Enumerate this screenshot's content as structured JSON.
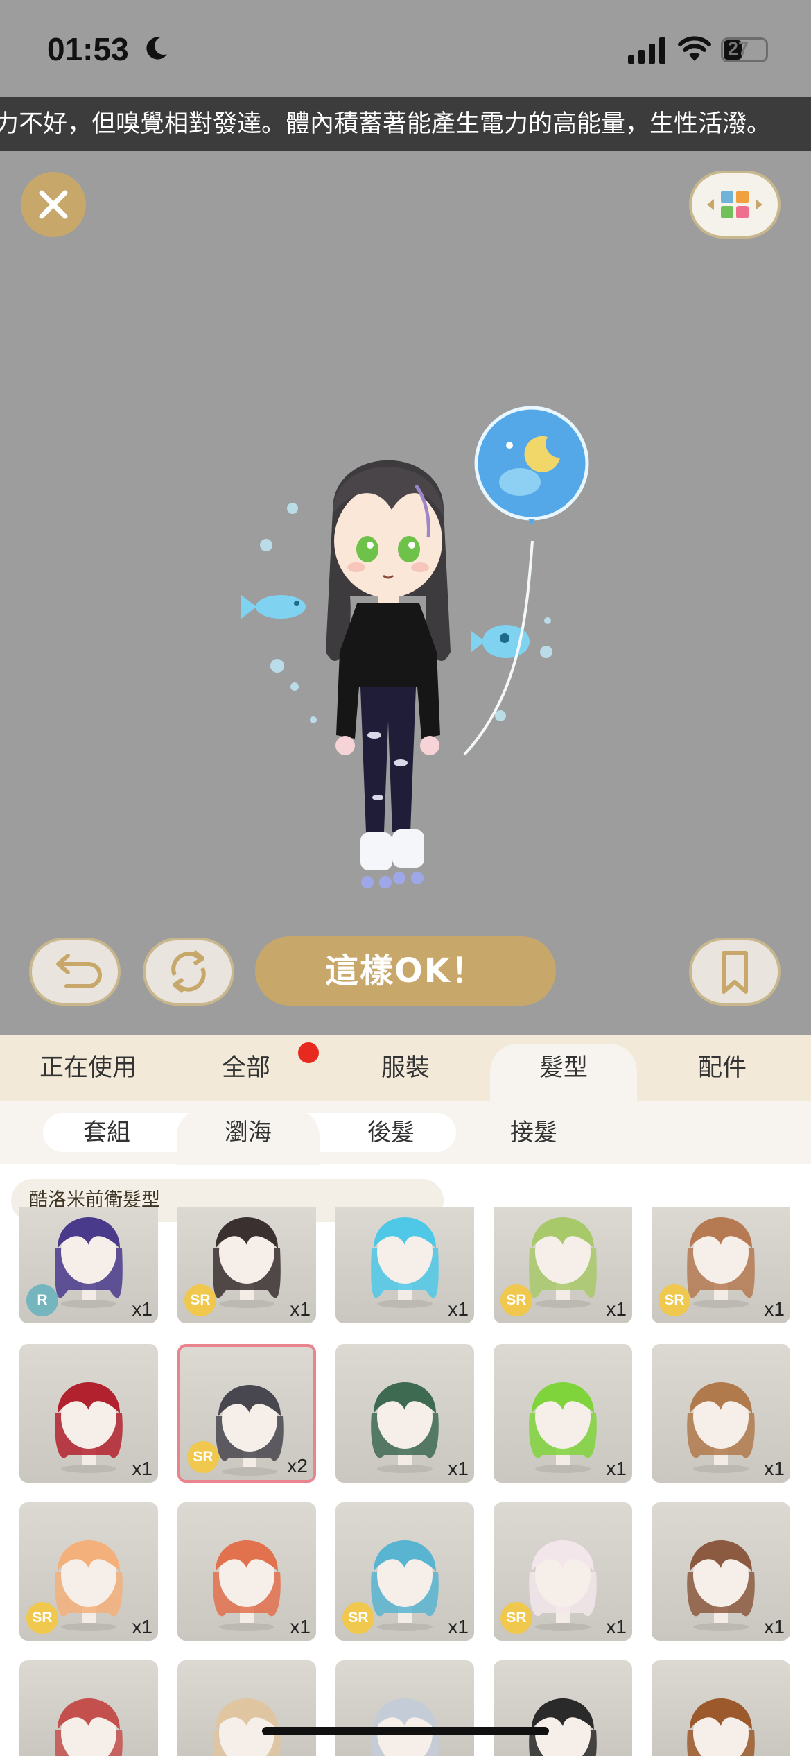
{
  "status_bar": {
    "time": "01:53",
    "battery": "27"
  },
  "ticker": {
    "text": "力不好，但嗅覺相對發達。體內積蓄著能產生電力的高能量，生性活潑。"
  },
  "actions": {
    "ok_label": "這樣OK！"
  },
  "tabs": [
    {
      "label": "正在使用"
    },
    {
      "label": "全部"
    },
    {
      "label": "服裝"
    },
    {
      "label": "髮型"
    },
    {
      "label": "配件"
    }
  ],
  "active_tab": "髮型",
  "subtabs": [
    {
      "label": "套組"
    },
    {
      "label": "瀏海"
    },
    {
      "label": "後髮"
    },
    {
      "label": "接髮"
    }
  ],
  "active_subtab": "瀏海",
  "series_label": "酷洛米前衛髮型",
  "items": [
    {
      "rarity": "R",
      "count": "x1",
      "color": "#4a3a8c"
    },
    {
      "rarity": "SR",
      "count": "x1",
      "color": "#3a3030"
    },
    {
      "rarity": "",
      "count": "x1",
      "color": "#4fc8e8"
    },
    {
      "rarity": "SR",
      "count": "x1",
      "color": "#a8c96a"
    },
    {
      "rarity": "SR",
      "count": "x1",
      "color": "#b57a52"
    },
    {
      "rarity": "",
      "count": "x1",
      "color": "#b2222e"
    },
    {
      "rarity": "SR",
      "count": "x2",
      "color": "#48464e",
      "selected": true
    },
    {
      "rarity": "",
      "count": "x1",
      "color": "#3e6a52"
    },
    {
      "rarity": "",
      "count": "x1",
      "color": "#7fd43c"
    },
    {
      "rarity": "",
      "count": "x1",
      "color": "#b07a4c"
    },
    {
      "rarity": "SR",
      "count": "x1",
      "color": "#f3b07a"
    },
    {
      "rarity": "",
      "count": "x1",
      "color": "#e2714e"
    },
    {
      "rarity": "SR",
      "count": "x1",
      "color": "#58b4d0"
    },
    {
      "rarity": "SR",
      "count": "x1",
      "color": "#f2e6ea"
    },
    {
      "rarity": "",
      "count": "x1",
      "color": "#8c5a40"
    },
    {
      "rarity": "",
      "count": "",
      "color": "#c4504e"
    },
    {
      "rarity": "",
      "count": "",
      "color": "#e0c6a0"
    },
    {
      "rarity": "",
      "count": "",
      "color": "#c4ccd8"
    },
    {
      "rarity": "",
      "count": "",
      "color": "#2a2a2a"
    },
    {
      "rarity": "",
      "count": "",
      "color": "#9c5a2c"
    }
  ]
}
